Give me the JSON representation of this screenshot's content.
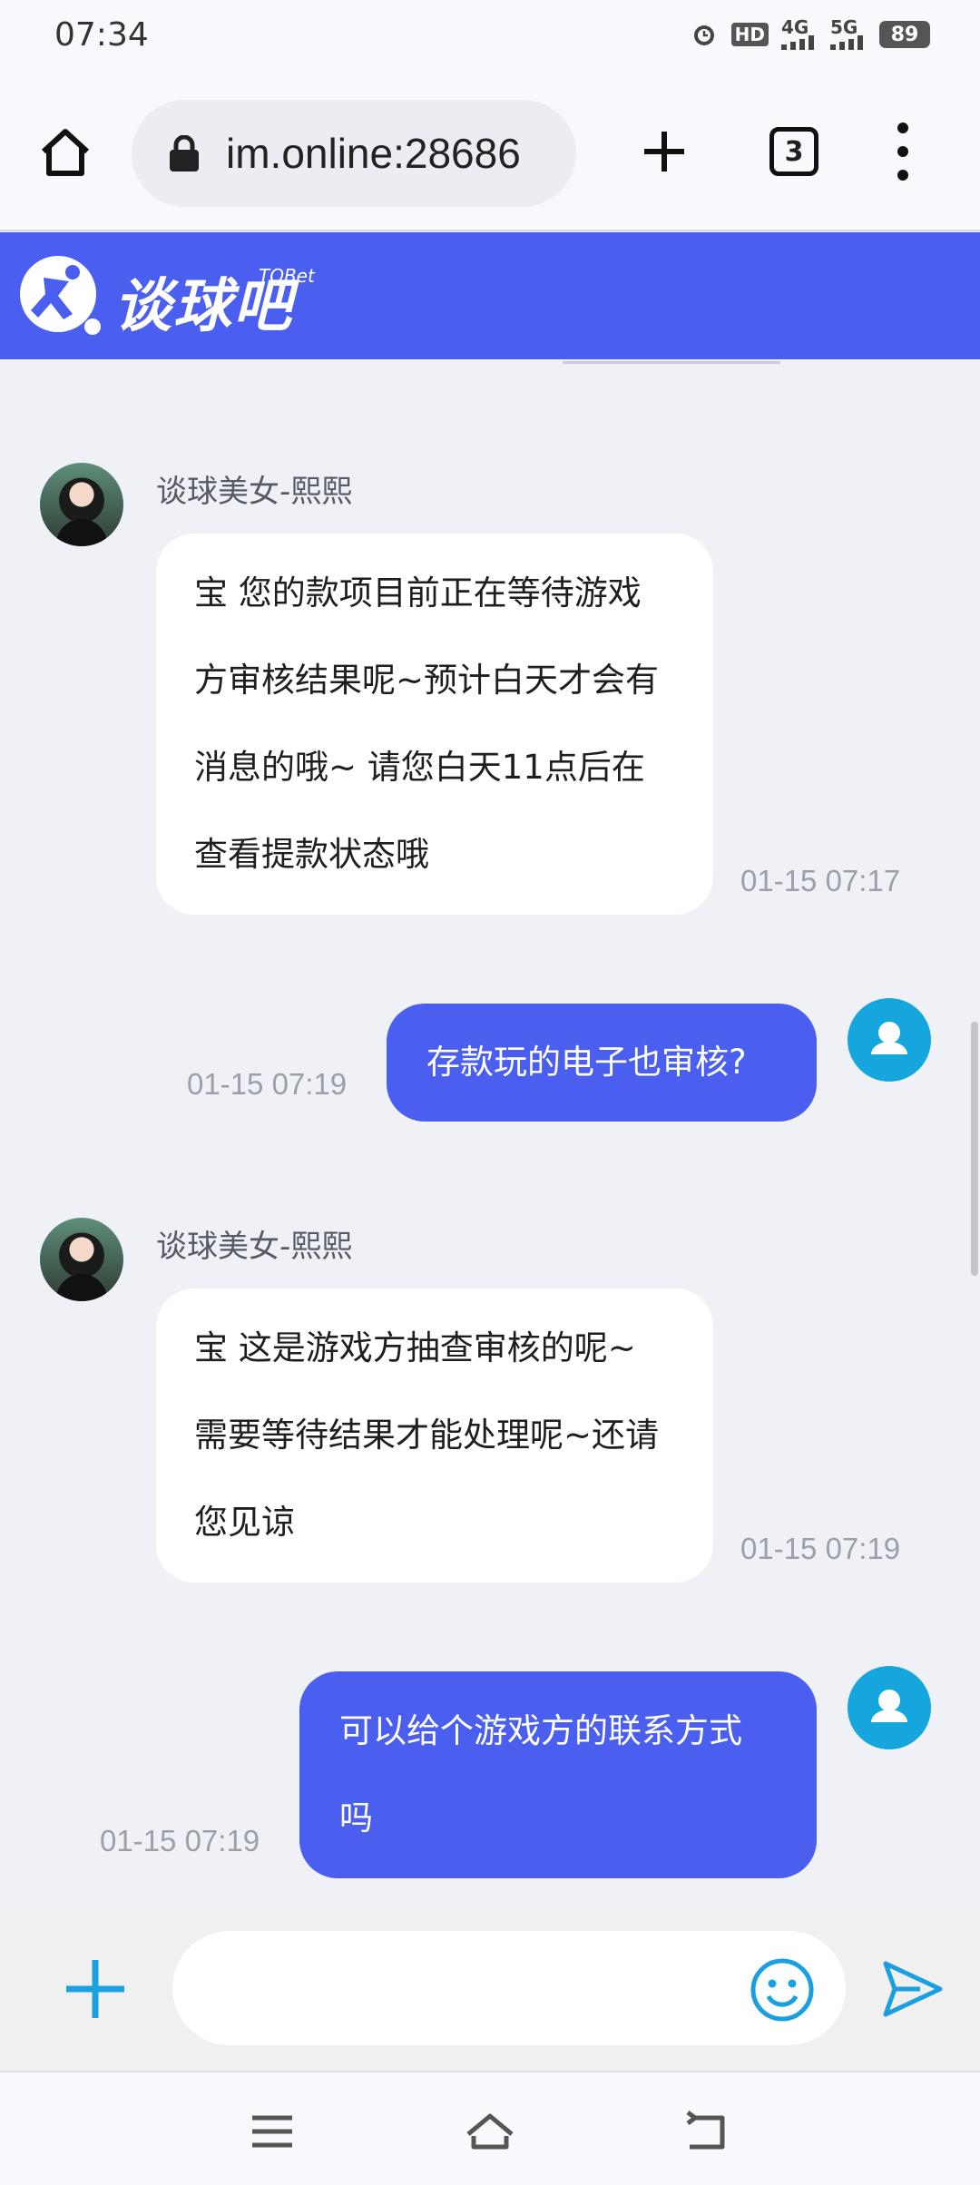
{
  "status_bar": {
    "time": "07:34",
    "hd_label": "HD",
    "net1": "4G",
    "net2": "5G",
    "battery": "89"
  },
  "browser": {
    "url": "im.online:28686",
    "tab_count": "3"
  },
  "site": {
    "logo_text": "谈球吧",
    "logo_sub": "TQBet"
  },
  "chat": {
    "messages": [
      {
        "sender": "谈球美女-熙熙",
        "lines": [
          "宝 您的款项目前正在等待游戏",
          "方审核结果呢~预计白天才会有",
          "消息的哦~ 请您白天11点后在",
          "查看提款状态哦"
        ],
        "time": "01-15 07:17"
      },
      {
        "lines": [
          "存款玩的电子也审核?"
        ],
        "time": "01-15 07:19"
      },
      {
        "sender": "谈球美女-熙熙",
        "lines": [
          "宝 这是游戏方抽查审核的呢~",
          "需要等待结果才能处理呢~还请",
          "您见谅"
        ],
        "time": "01-15 07:19"
      },
      {
        "lines": [
          "可以给个游戏方的联系方式",
          "吗"
        ],
        "time": "01-15 07:19"
      }
    ]
  },
  "input": {
    "placeholder": ""
  },
  "colors": {
    "brand": "#4a5ef0",
    "user_avatar": "#14a6dc",
    "accent_icon": "#1aa0e0"
  }
}
